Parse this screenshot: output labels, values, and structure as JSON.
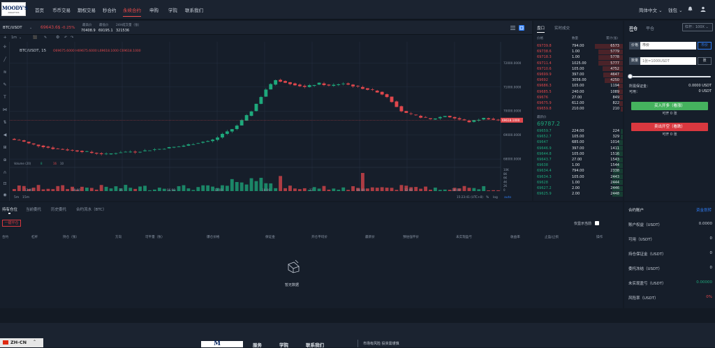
{
  "brand": {
    "line1": "MOODY'S",
    "line2": "ANALYTICS"
  },
  "nav": {
    "items": [
      {
        "label": "首页"
      },
      {
        "label": "币币交易"
      },
      {
        "label": "期权交易"
      },
      {
        "label": "秒合约"
      },
      {
        "label": "永续合约"
      },
      {
        "label": "申购"
      },
      {
        "label": "学院"
      },
      {
        "label": "联系我们"
      }
    ],
    "language": "简体中文 ⌄",
    "user": "钱包 ⌄"
  },
  "ticker": {
    "pair": "BTC/USDT",
    "pair_arrow": "⌄",
    "price": "69643.6$",
    "change": "-0.25%",
    "high_label": "最高价",
    "high": "70408.9",
    "low_label": "最低价",
    "low": "69195.1",
    "vol_label": "24H成交量（张）",
    "vol": "321536",
    "icons": [
      "menu-icon",
      "fullscreen-icon"
    ]
  },
  "chart_toolbar": {
    "items": [
      "1m",
      "⌄",
      "⬛",
      "✎"
    ]
  },
  "chart_legend": {
    "title": "BTC/USDT, 15",
    "ohlc": "O69675.6000 H69675.6000 L69618.1000 C69618.1000"
  },
  "chart_data": {
    "type": "candlestick",
    "symbol": "BTC/USDT",
    "interval": "15",
    "y_ticks": [
      "72000.0000",
      "71000.0000",
      "70000.0000",
      "69000.0000",
      "68000.0000"
    ],
    "ylim": [
      67800,
      72300
    ],
    "last_price_label": "69618.1000",
    "close_series": [
      68800,
      68780,
      68720,
      68650,
      68600,
      68560,
      68520,
      68480,
      68440,
      68420,
      68400,
      68380,
      68360,
      68340,
      68320,
      68300,
      68260,
      68240,
      68220,
      68200,
      68230,
      68260,
      68290,
      68300,
      68310,
      68300,
      68330,
      68350,
      68380,
      68400,
      68420,
      68450,
      68480,
      68500,
      68520,
      68560,
      68600,
      68640,
      68680,
      68720,
      68750,
      68800,
      68900,
      69050,
      69150,
      69250,
      69400,
      69600,
      69800,
      70000,
      70300,
      70600,
      70900,
      71100,
      71300,
      71250,
      71200,
      71150,
      71100,
      71050,
      71000,
      71050,
      71100,
      71150,
      71100,
      71050,
      71080,
      71120,
      71150,
      71100,
      71050,
      71000,
      70950,
      70900,
      70850,
      70800,
      70700,
      70600,
      70400,
      70200,
      70000,
      69900,
      69850,
      69800,
      69750,
      69700,
      69650,
      69700,
      69750,
      69800,
      69750,
      69700,
      69650,
      69600,
      69550,
      69600,
      69650,
      69700,
      69680,
      69640,
      69620
    ],
    "volume_label": "Volume (20)",
    "volume_values": [
      "8",
      "16",
      "10"
    ],
    "volume_ticks": [
      "10K",
      "8K",
      "6K",
      "4K",
      "2K",
      "0"
    ],
    "x_ticks": [
      "12:00",
      "18:00",
      "21",
      "06:00",
      "12:00",
      "18:00",
      "22",
      "06:00",
      "12:00",
      "18:00"
    ],
    "timeframes": [
      "1m",
      "5m",
      "15m"
    ],
    "bottom_info": "15:23:41 (UTC+8)",
    "scale_opts": [
      "%",
      "log",
      "auto"
    ]
  },
  "orderbook": {
    "tabs": [
      {
        "label": "盘口"
      },
      {
        "label": "实时成交"
      }
    ],
    "headers": [
      "价格",
      "数量",
      "累计(张)"
    ],
    "asks": [
      [
        "69739.8",
        "794.00",
        "6573"
      ],
      [
        "69738.6",
        "1.00",
        "5779"
      ],
      [
        "69718.3",
        "1.00",
        "5778"
      ],
      [
        "69711.4",
        "1025.00",
        "5777"
      ],
      [
        "69710.6",
        "105.00",
        "4752"
      ],
      [
        "69699.9",
        "397.00",
        "4647"
      ],
      [
        "69692",
        "3056.00",
        "4250"
      ],
      [
        "69686.3",
        "105.00",
        "1194"
      ],
      [
        "69685.5",
        "240.00",
        "1089"
      ],
      [
        "69676",
        "27.00",
        "849"
      ],
      [
        "69675.9",
        "612.00",
        "822"
      ],
      [
        "69659.8",
        "210.00",
        "210"
      ]
    ],
    "mark_label": "最新价",
    "mark_price": "69787.2",
    "bids": [
      [
        "69659.7",
        "224.00",
        "224"
      ],
      [
        "69652.7",
        "105.00",
        "329"
      ],
      [
        "69647",
        "685.00",
        "1014"
      ],
      [
        "69646.9",
        "397.00",
        "1411"
      ],
      [
        "69644.8",
        "105.00",
        "1516"
      ],
      [
        "69643.7",
        "27.00",
        "1543"
      ],
      [
        "69638",
        "1.00",
        "1544"
      ],
      [
        "69634.4",
        "794.00",
        "2338"
      ],
      [
        "69634.3",
        "105.00",
        "2443"
      ],
      [
        "69628",
        "1.00",
        "2444"
      ],
      [
        "69627.2",
        "2.00",
        "2446"
      ],
      [
        "69625.9",
        "2.00",
        "2448"
      ]
    ]
  },
  "trade": {
    "tab_open": "开仓",
    "tab_close": "平仓",
    "leverage": "杠杆：100X ⌄",
    "price_label": "价格",
    "price_value": "市价",
    "price_btn": "市价",
    "qty_label": "数量",
    "qty_placeholder": "1张=1000USDT",
    "qty_btn": "张",
    "margin_label": "所需保证金：",
    "margin_value": "0.0000 USDT",
    "avail_label": "可用：",
    "avail_value": "0 USDT",
    "buy_btn": "买入开多（看涨）",
    "buy_sub": "可开 0 张",
    "sell_btn": "卖出开空（看跌）",
    "sell_sub": "可开 0 张"
  },
  "positions": {
    "tabs": [
      {
        "label": "持有仓位"
      },
      {
        "label": "当前委托"
      },
      {
        "label": "历史委托"
      },
      {
        "label": "合约流水（BTC）"
      }
    ],
    "close_all": "一键平仓",
    "show_all": "仅显示当前",
    "columns": [
      "合约",
      "杠杆",
      "持仓（张）",
      "方向",
      "可平量（张）",
      "爆仓价格",
      "保证金",
      "开仓平均价",
      "最新价",
      "预估强平价",
      "未实现盈亏",
      "收益率",
      "止盈/止损",
      "操作"
    ],
    "empty": "暂无数据"
  },
  "account": {
    "title": "合约账户",
    "transfer": "资金划转",
    "rows": [
      {
        "label": "账户权益（USDT）",
        "value": "0.0000"
      },
      {
        "label": "可用（USDT）",
        "value": "0"
      },
      {
        "label": "持仓保证金（USDT）",
        "value": "0"
      },
      {
        "label": "委托冻结（USDT）",
        "value": "0"
      },
      {
        "label": "未实现盈亏（USDT）",
        "value": "0.00000"
      },
      {
        "label": "风险率（USDT）",
        "value": "0%"
      }
    ]
  },
  "footer": {
    "lang": "ZH-CN",
    "lang_arrow": "⌃",
    "links": [
      {
        "label": "服务"
      },
      {
        "label": "学院"
      },
      {
        "label": "联系我们"
      }
    ],
    "risk": "市场有风险 投资需谨慎"
  },
  "colors": {
    "up": "#1ea97c",
    "down": "#e0474c",
    "accent": "#2f7df6",
    "active_nav": "#ef4b4b"
  }
}
